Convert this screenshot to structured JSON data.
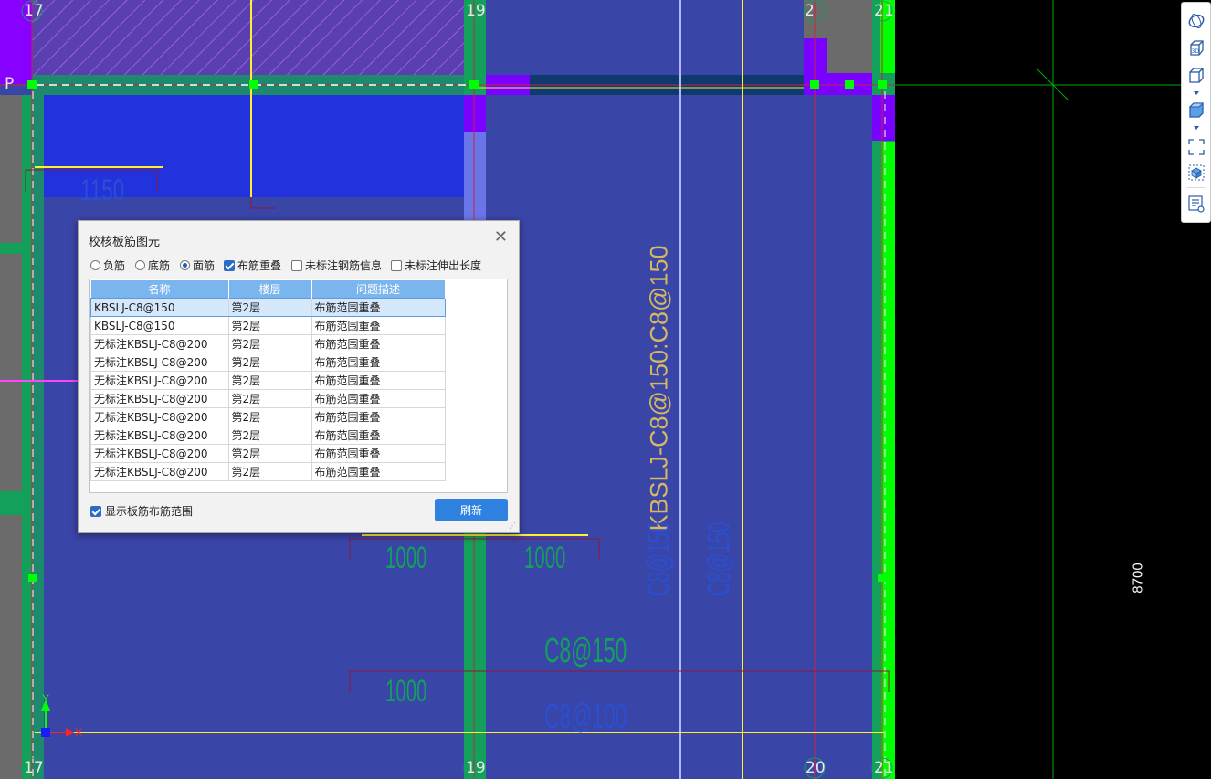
{
  "axes": {
    "top": [
      "17",
      "19",
      "2",
      "21"
    ],
    "bottom": [
      "17",
      "19",
      "20",
      "21"
    ],
    "row_marker": "P"
  },
  "cad_labels": {
    "dim_1150": "1150",
    "dim_1000_a": "1000",
    "dim_1000_b": "1000",
    "dim_1000_c": "1000",
    "rebar_c8_150": "C8@150",
    "rebar_c8_100": "C8@100",
    "rebar_vertical": "KBSLJ-C8@150:C8@150",
    "rebar_vert_small_1": "C8@150",
    "rebar_vert_small_2": "C8@150",
    "dimension_8700": "8700",
    "ucs_x": "X",
    "ucs_y": "Y"
  },
  "colors": {
    "background": "#000000",
    "slab": "#3a45a8",
    "wall_green": "#12a05a",
    "bright_green": "#00ff00",
    "beam_purple": "#7a00ff",
    "rebar_yellow": "#ffee33",
    "axis_red": "#cc2244",
    "accent_blue": "#2e81de"
  },
  "dialog": {
    "title": "校核板筋图元",
    "options": {
      "neg_rebar": "负筋",
      "bottom_rebar": "底筋",
      "top_rebar": "面筋",
      "overlap": "布筋重叠",
      "no_label_info": "未标注钢筋信息",
      "no_label_ext": "未标注伸出长度"
    },
    "selected_radio": "面筋",
    "columns": [
      "名称",
      "楼层",
      "问题描述"
    ],
    "rows": [
      {
        "name": "KBSLJ-C8@150",
        "floor": "第2层",
        "issue": "布筋范围重叠"
      },
      {
        "name": "KBSLJ-C8@150",
        "floor": "第2层",
        "issue": "布筋范围重叠"
      },
      {
        "name": "无标注KBSLJ-C8@200",
        "floor": "第2层",
        "issue": "布筋范围重叠"
      },
      {
        "name": "无标注KBSLJ-C8@200",
        "floor": "第2层",
        "issue": "布筋范围重叠"
      },
      {
        "name": "无标注KBSLJ-C8@200",
        "floor": "第2层",
        "issue": "布筋范围重叠"
      },
      {
        "name": "无标注KBSLJ-C8@200",
        "floor": "第2层",
        "issue": "布筋范围重叠"
      },
      {
        "name": "无标注KBSLJ-C8@200",
        "floor": "第2层",
        "issue": "布筋范围重叠"
      },
      {
        "name": "无标注KBSLJ-C8@200",
        "floor": "第2层",
        "issue": "布筋范围重叠"
      },
      {
        "name": "无标注KBSLJ-C8@200",
        "floor": "第2层",
        "issue": "布筋范围重叠"
      },
      {
        "name": "无标注KBSLJ-C8@200",
        "floor": "第2层",
        "issue": "布筋范围重叠"
      }
    ],
    "show_range_label": "显示板筋布筋范围",
    "refresh_label": "刷新"
  },
  "toolbar": {
    "icons": [
      "orbit-icon",
      "view-3d-icon",
      "box-view-icon",
      "dropdown-arrow-icon",
      "solid-box-icon",
      "dropdown-arrow-icon",
      "fullscreen-icon",
      "select-box-icon",
      "report-icon"
    ],
    "view3d_label": "3D"
  }
}
